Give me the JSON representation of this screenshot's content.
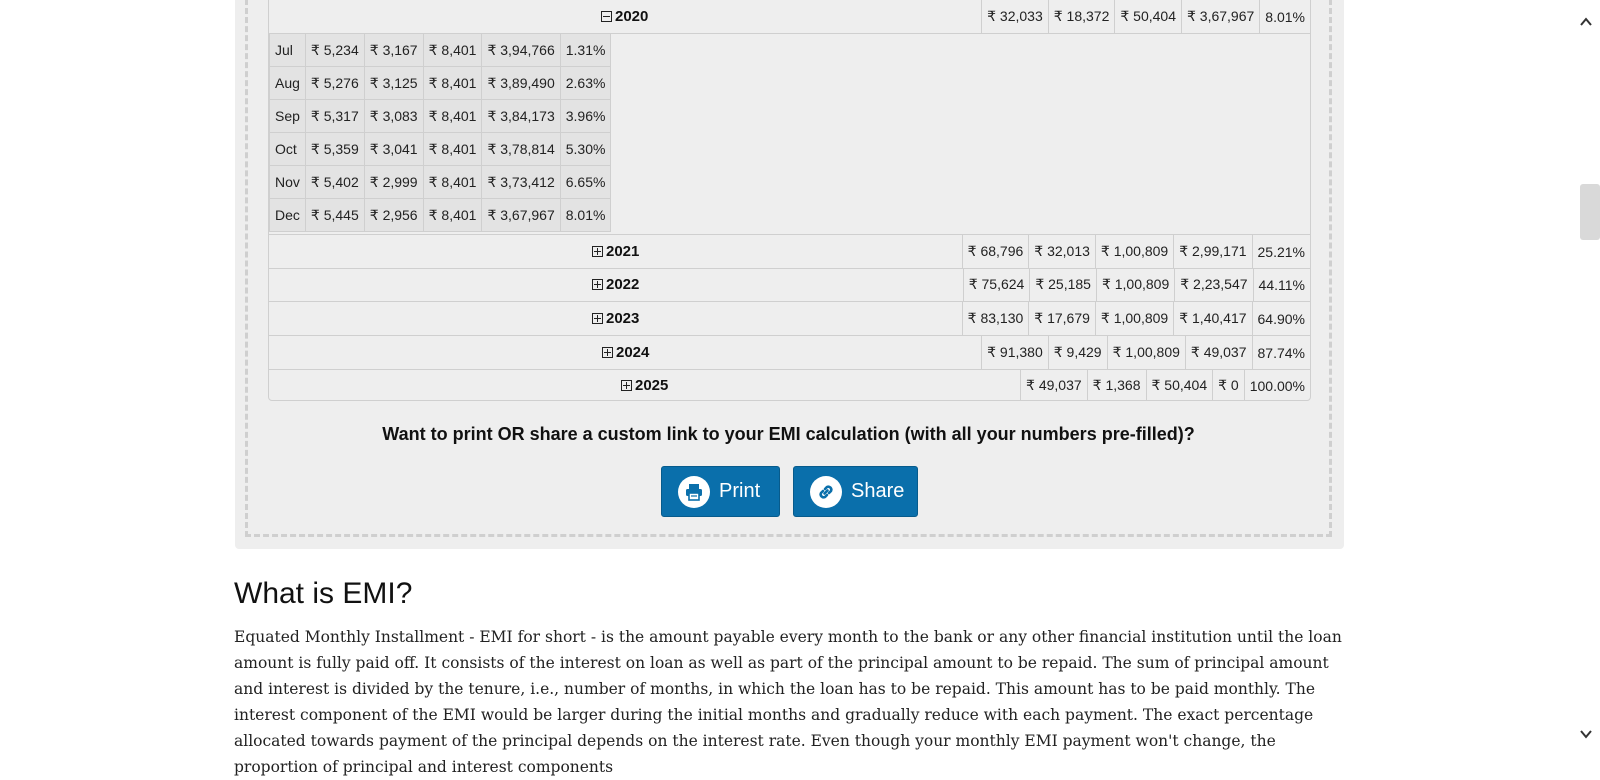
{
  "currency_symbol": "₹",
  "years": [
    {
      "year": "2020",
      "expanded": true,
      "principal": "₹ 32,033",
      "interest": "₹ 18,372",
      "total": "₹ 50,404",
      "balance": "₹ 3,67,967",
      "paid": "8.01%"
    },
    {
      "year": "2021",
      "expanded": false,
      "principal": "₹ 68,796",
      "interest": "₹ 32,013",
      "total": "₹ 1,00,809",
      "balance": "₹ 2,99,171",
      "paid": "25.21%"
    },
    {
      "year": "2022",
      "expanded": false,
      "principal": "₹ 75,624",
      "interest": "₹ 25,185",
      "total": "₹ 1,00,809",
      "balance": "₹ 2,23,547",
      "paid": "44.11%"
    },
    {
      "year": "2023",
      "expanded": false,
      "principal": "₹ 83,130",
      "interest": "₹ 17,679",
      "total": "₹ 1,00,809",
      "balance": "₹ 1,40,417",
      "paid": "64.90%"
    },
    {
      "year": "2024",
      "expanded": false,
      "principal": "₹ 91,380",
      "interest": "₹ 9,429",
      "total": "₹ 1,00,809",
      "balance": "₹ 49,037",
      "paid": "87.74%"
    },
    {
      "year": "2025",
      "expanded": false,
      "principal": "₹ 49,037",
      "interest": "₹ 1,368",
      "total": "₹ 50,404",
      "balance": "₹ 0",
      "paid": "100.00%"
    }
  ],
  "months": [
    {
      "month": "Jul",
      "principal": "₹ 5,234",
      "interest": "₹ 3,167",
      "total": "₹ 8,401",
      "balance": "₹ 3,94,766",
      "paid": "1.31%"
    },
    {
      "month": "Aug",
      "principal": "₹ 5,276",
      "interest": "₹ 3,125",
      "total": "₹ 8,401",
      "balance": "₹ 3,89,490",
      "paid": "2.63%"
    },
    {
      "month": "Sep",
      "principal": "₹ 5,317",
      "interest": "₹ 3,083",
      "total": "₹ 8,401",
      "balance": "₹ 3,84,173",
      "paid": "3.96%"
    },
    {
      "month": "Oct",
      "principal": "₹ 5,359",
      "interest": "₹ 3,041",
      "total": "₹ 8,401",
      "balance": "₹ 3,78,814",
      "paid": "5.30%"
    },
    {
      "month": "Nov",
      "principal": "₹ 5,402",
      "interest": "₹ 2,999",
      "total": "₹ 8,401",
      "balance": "₹ 3,73,412",
      "paid": "6.65%"
    },
    {
      "month": "Dec",
      "principal": "₹ 5,445",
      "interest": "₹ 2,956",
      "total": "₹ 8,401",
      "balance": "₹ 3,67,967",
      "paid": "8.01%"
    }
  ],
  "share": {
    "prompt": "Want to print OR share a custom link to your EMI calculation (with all your numbers pre-filled)?",
    "print_label": "Print",
    "share_label": "Share"
  },
  "article": {
    "heading": "What is EMI?",
    "paragraph": "Equated Monthly Installment - EMI for short - is the amount payable every month to the bank or any other financial institution until the loan amount is fully paid off. It consists of the interest on loan as well as part of the principal amount to be repaid. The sum of principal amount and interest is divided by the tenure, i.e., number of months, in which the loan has to be repaid. This amount has to be paid monthly. The interest component of the EMI would be larger during the initial months and gradually reduce with each payment. The exact percentage allocated towards payment of the principal depends on the interest rate. Even though your monthly EMI payment won't change, the proportion of principal and interest components"
  },
  "colors": {
    "button_blue": "#0a6fab",
    "panel_gray": "#eeeeee",
    "month_cell_gray": "#e3e3e3"
  }
}
